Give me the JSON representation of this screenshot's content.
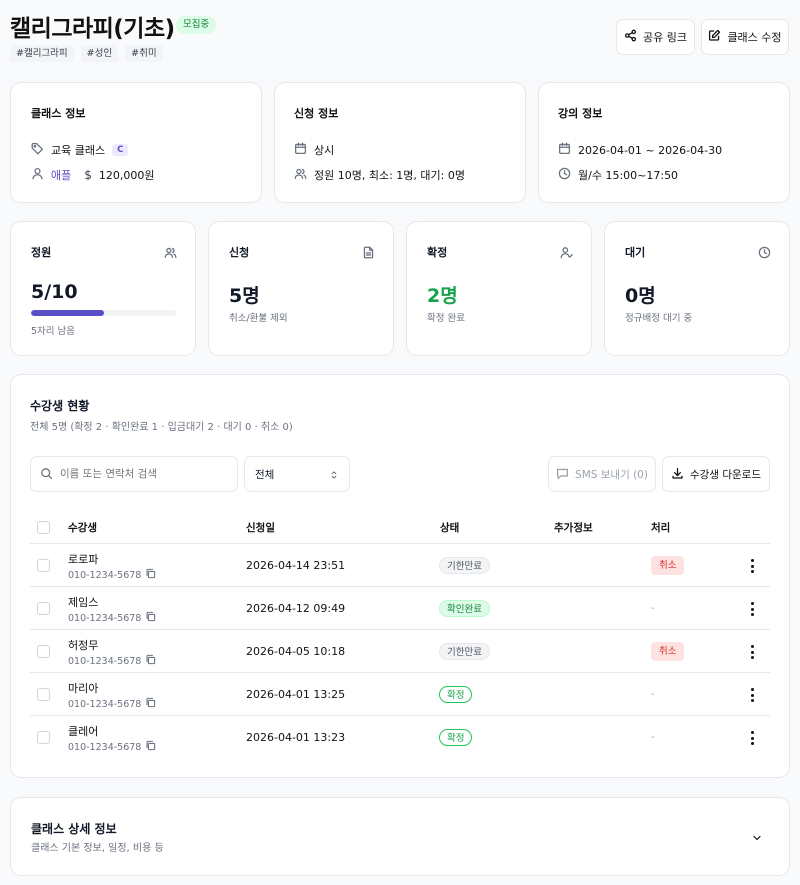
{
  "header": {
    "title": "캘리그라피(기초)",
    "status_badge": "모집중",
    "tags": [
      "#캘리그라피",
      "#성인",
      "#취미"
    ],
    "share_label": "공유 링크",
    "edit_label": "클래스 수정"
  },
  "class_info": {
    "title": "클래스 정보",
    "type_label": "교육 클래스",
    "type_badge": "C",
    "instructor": "애플",
    "price": "120,000원"
  },
  "apply_info": {
    "title": "신청 정보",
    "period": "상시",
    "capacity": "정원 10명, 최소: 1명, 대기: 0명"
  },
  "lecture_info": {
    "title": "강의 정보",
    "date_range": "2026-04-01 ~ 2026-04-30",
    "schedule": "월/수 15:00~17:50"
  },
  "stats": {
    "capacity": {
      "label": "정원",
      "value": "5/10",
      "sub": "5자리 남음",
      "progress": 0.5
    },
    "applied": {
      "label": "신청",
      "value": "5명",
      "sub": "취소/환불 제외"
    },
    "confirmed": {
      "label": "확정",
      "value": "2명",
      "sub": "확정 완료"
    },
    "waiting": {
      "label": "대기",
      "value": "0명",
      "sub": "정규배정 대기 중"
    }
  },
  "students": {
    "title": "수강생 현황",
    "summary": "전체 5명 (확정 2 · 확인완료 1 · 입금대기 2 · 대기 0 · 취소 0)",
    "search_placeholder": "이름 또는 연락처 검색",
    "filter_value": "전체",
    "sms_label": "SMS 보내기 (0)",
    "download_label": "수강생 다운로드",
    "columns": [
      "수강생",
      "신청일",
      "상태",
      "추가정보",
      "처리"
    ],
    "rows": [
      {
        "name": "로로파",
        "phone": "010-1234-5678",
        "date": "2026-04-14 23:51",
        "status": "기한만료",
        "action": "취소"
      },
      {
        "name": "제임스",
        "phone": "010-1234-5678",
        "date": "2026-04-12 09:49",
        "status": "확인완료",
        "action": "-"
      },
      {
        "name": "허정무",
        "phone": "010-1234-5678",
        "date": "2026-04-05 10:18",
        "status": "기한만료",
        "action": "취소"
      },
      {
        "name": "마리아",
        "phone": "010-1234-5678",
        "date": "2026-04-01 13:25",
        "status": "확정",
        "action": "-"
      },
      {
        "name": "클레어",
        "phone": "010-1234-5678",
        "date": "2026-04-01 13:23",
        "status": "확정",
        "action": "-"
      }
    ]
  },
  "details": {
    "title": "클래스 상세 정보",
    "subtitle": "클래스 기본 정보, 일정, 비용 등"
  },
  "colors": {
    "accent": "#5b4fc7",
    "progress_track": "#f3f4f6",
    "confirmed_green": "#16a34a",
    "cancel_red": "#dc2626"
  }
}
